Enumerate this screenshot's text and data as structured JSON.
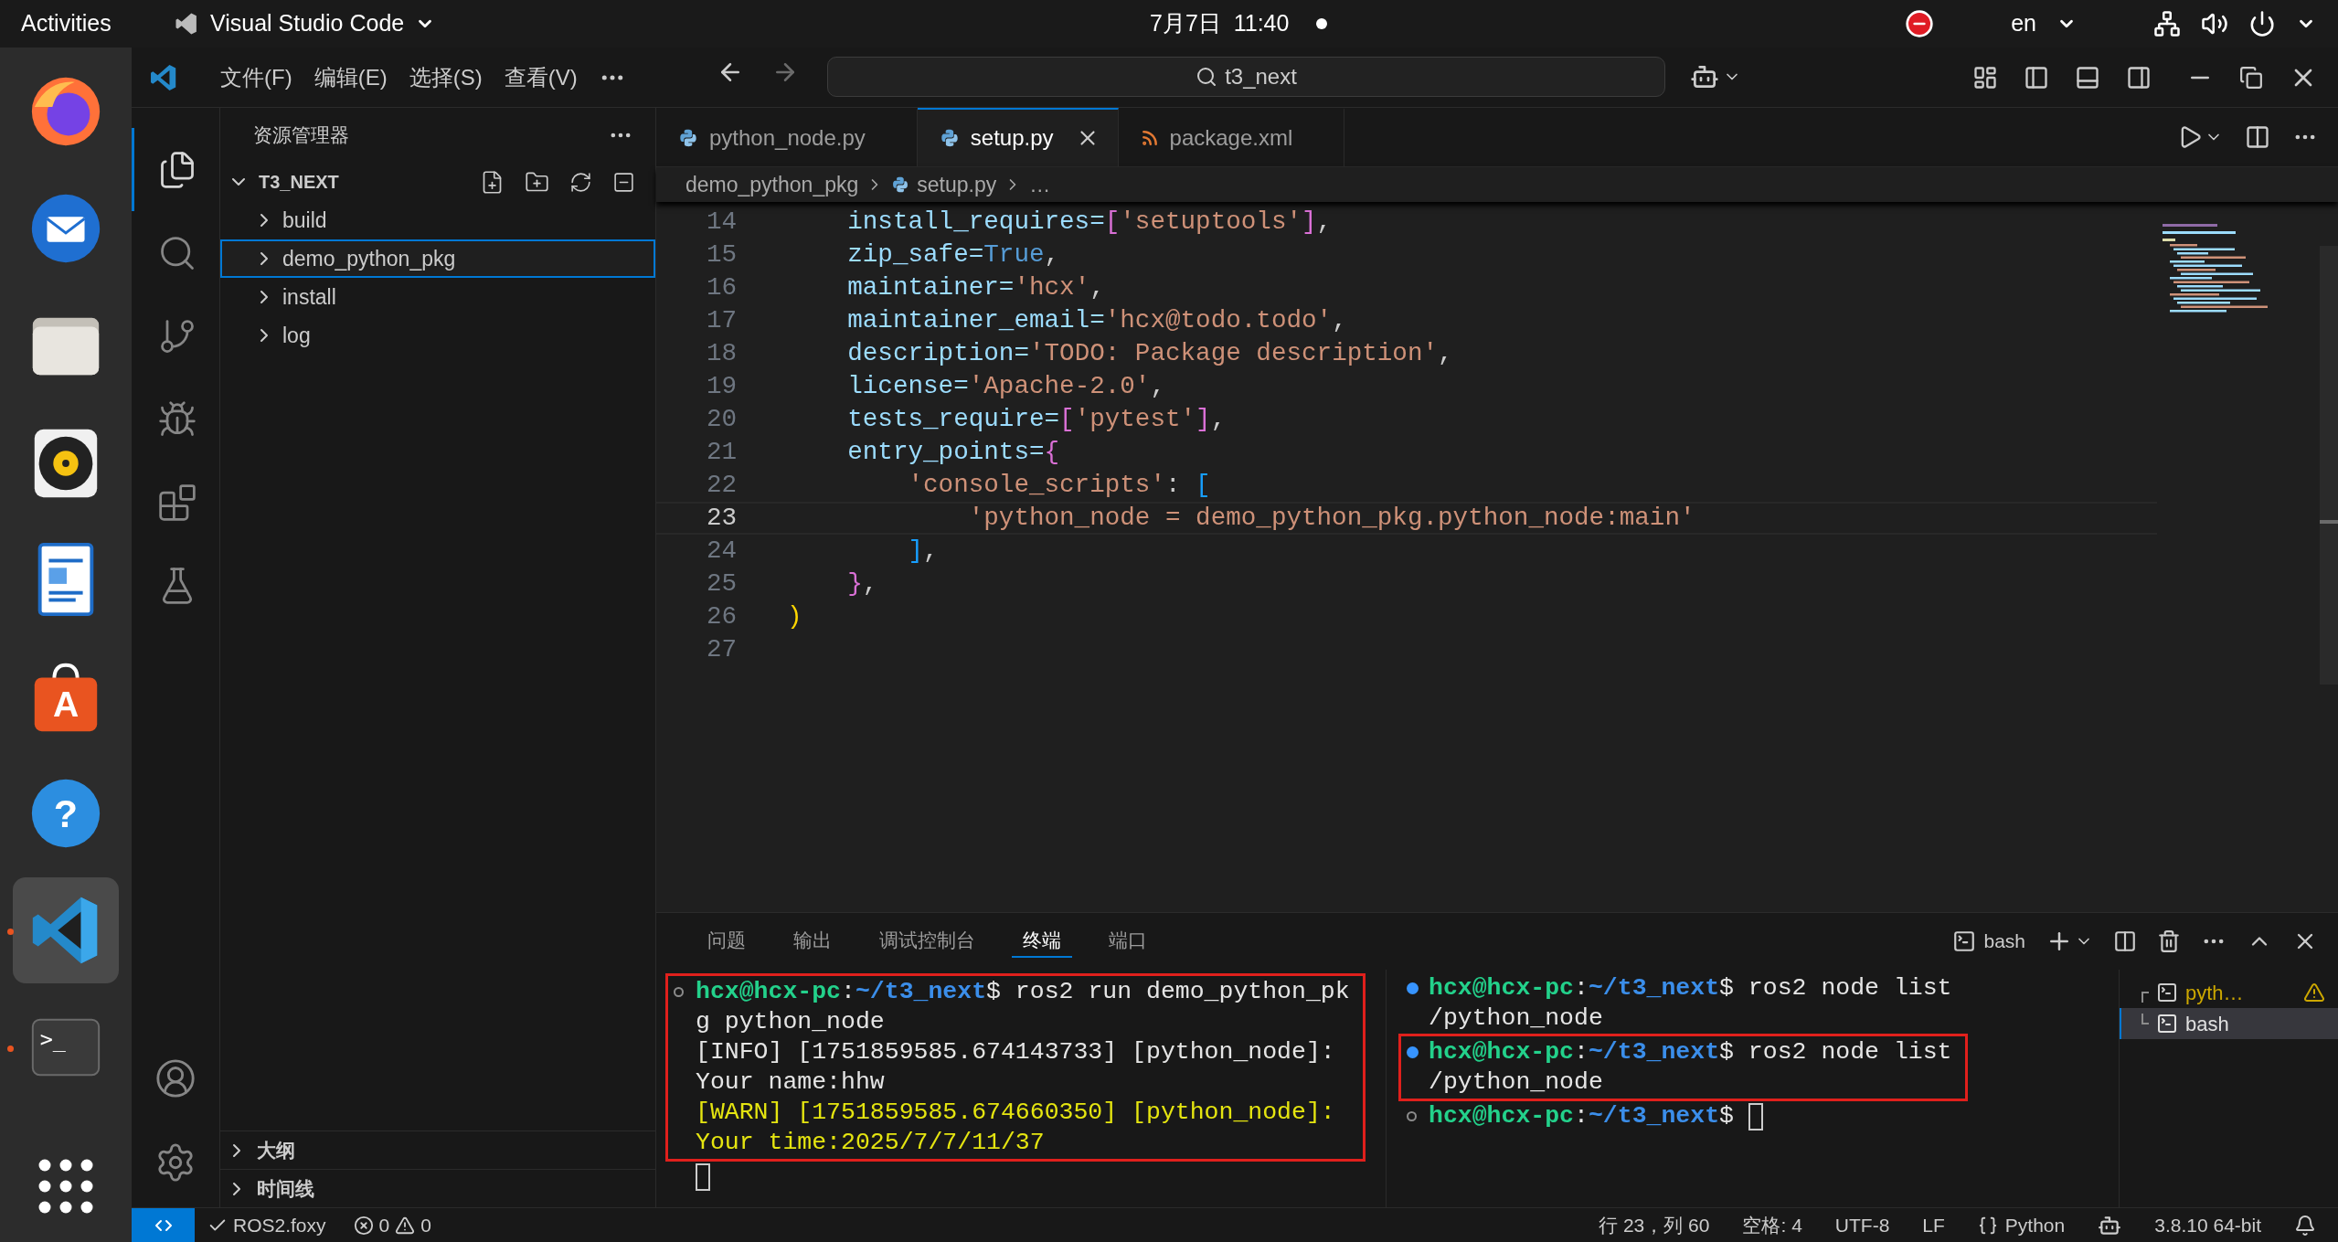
{
  "top_bar": {
    "activities": "Activities",
    "app_name": "Visual Studio Code",
    "date": "7月7日",
    "time": "11:40",
    "keyboard_layout": "en"
  },
  "dock": {
    "items": [
      {
        "kind": "browser",
        "running": false,
        "selected": false
      },
      {
        "kind": "mail",
        "running": false,
        "selected": false
      },
      {
        "kind": "files",
        "running": false,
        "selected": false
      },
      {
        "kind": "music",
        "running": false,
        "selected": false
      },
      {
        "kind": "document",
        "running": false,
        "selected": false
      },
      {
        "kind": "store",
        "glyph": "A",
        "running": false,
        "selected": false
      },
      {
        "kind": "help",
        "glyph": "?",
        "running": false,
        "selected": false
      },
      {
        "kind": "editor",
        "running": true,
        "selected": true
      },
      {
        "kind": "terminal",
        "glyph": ">_",
        "running": true,
        "selected": false
      }
    ]
  },
  "title_bar": {
    "menus": [
      "文件(F)",
      "编辑(E)",
      "选择(S)",
      "查看(V)"
    ],
    "search": "t3_next"
  },
  "activity_bar": {
    "items": [
      {
        "kind": "explorer",
        "selected": true
      },
      {
        "kind": "search",
        "selected": false
      },
      {
        "kind": "source_control",
        "selected": false
      },
      {
        "kind": "debug",
        "selected": false
      },
      {
        "kind": "extensions",
        "selected": false
      },
      {
        "kind": "testing",
        "selected": false
      }
    ]
  },
  "sidebar": {
    "title": "资源管理器",
    "root": {
      "label": "T3_NEXT",
      "expanded": true
    },
    "items": [
      {
        "label": "build",
        "expanded": false,
        "selected": false
      },
      {
        "label": "demo_python_pkg",
        "expanded": false,
        "selected": true
      },
      {
        "label": "install",
        "expanded": false,
        "selected": false
      },
      {
        "label": "log",
        "expanded": false,
        "selected": false
      }
    ],
    "sections": [
      {
        "label": "大纲",
        "expanded": false
      },
      {
        "label": "时间线",
        "expanded": false
      }
    ]
  },
  "tabs": [
    {
      "label": "python_node.py",
      "kind": "python",
      "selected": false
    },
    {
      "label": "setup.py",
      "kind": "python",
      "selected": true
    },
    {
      "label": "package.xml",
      "kind": "xml",
      "selected": false
    }
  ],
  "breadcrumb": [
    {
      "label": "demo_python_pkg",
      "kind": "folder"
    },
    {
      "label": "setup.py",
      "kind": "python"
    },
    {
      "label": "…",
      "kind": "symbol"
    }
  ],
  "editor": {
    "lines": [
      {
        "number": "14",
        "current": false,
        "tokens": [
          {
            "text": "    install_requires=",
            "kind": "key"
          },
          {
            "text": "[",
            "kind": "b1"
          },
          {
            "text": "'setuptools'",
            "kind": "str"
          },
          {
            "text": "]",
            "kind": "b1"
          },
          {
            "text": ",",
            "kind": "op"
          }
        ]
      },
      {
        "number": "15",
        "current": false,
        "tokens": [
          {
            "text": "    zip_safe=",
            "kind": "key"
          },
          {
            "text": "True",
            "kind": "const"
          },
          {
            "text": ",",
            "kind": "op"
          }
        ]
      },
      {
        "number": "16",
        "current": false,
        "tokens": [
          {
            "text": "    maintainer=",
            "kind": "key"
          },
          {
            "text": "'hcx'",
            "kind": "str"
          },
          {
            "text": ",",
            "kind": "op"
          }
        ]
      },
      {
        "number": "17",
        "current": false,
        "tokens": [
          {
            "text": "    maintainer_email=",
            "kind": "key"
          },
          {
            "text": "'hcx@todo.todo'",
            "kind": "str"
          },
          {
            "text": ",",
            "kind": "op"
          }
        ]
      },
      {
        "number": "18",
        "current": false,
        "tokens": [
          {
            "text": "    description=",
            "kind": "key"
          },
          {
            "text": "'TODO: Package description'",
            "kind": "str"
          },
          {
            "text": ",",
            "kind": "op"
          }
        ]
      },
      {
        "number": "19",
        "current": false,
        "tokens": [
          {
            "text": "    license=",
            "kind": "key"
          },
          {
            "text": "'Apache-2.0'",
            "kind": "str"
          },
          {
            "text": ",",
            "kind": "op"
          }
        ]
      },
      {
        "number": "20",
        "current": false,
        "tokens": [
          {
            "text": "    tests_require=",
            "kind": "key"
          },
          {
            "text": "[",
            "kind": "b1"
          },
          {
            "text": "'pytest'",
            "kind": "str"
          },
          {
            "text": "]",
            "kind": "b1"
          },
          {
            "text": ",",
            "kind": "op"
          }
        ]
      },
      {
        "number": "21",
        "current": false,
        "tokens": [
          {
            "text": "    entry_points=",
            "kind": "key"
          },
          {
            "text": "{",
            "kind": "b1"
          }
        ]
      },
      {
        "number": "22",
        "current": false,
        "tokens": [
          {
            "text": "        'console_scripts'",
            "kind": "str"
          },
          {
            "text": ": ",
            "kind": "op"
          },
          {
            "text": "[",
            "kind": "b2"
          }
        ]
      },
      {
        "number": "23",
        "current": true,
        "tokens": [
          {
            "text": "            'python_node = demo_python_pkg.python_node:main'",
            "kind": "str"
          }
        ]
      },
      {
        "number": "24",
        "current": false,
        "tokens": [
          {
            "text": "        ]",
            "kind": "b2"
          },
          {
            "text": ",",
            "kind": "op"
          }
        ]
      },
      {
        "number": "25",
        "current": false,
        "tokens": [
          {
            "text": "    }",
            "kind": "b1"
          },
          {
            "text": ",",
            "kind": "op"
          }
        ]
      },
      {
        "number": "26",
        "current": false,
        "tokens": [
          {
            "text": ")",
            "kind": "b3"
          }
        ]
      },
      {
        "number": "27",
        "current": false
      }
    ]
  },
  "panel": {
    "tabs": [
      {
        "label": "问题",
        "selected": false
      },
      {
        "label": "输出",
        "selected": false
      },
      {
        "label": "调试控制台",
        "selected": false
      },
      {
        "label": "终端",
        "selected": true
      },
      {
        "label": "端口",
        "selected": false
      }
    ],
    "terminal_name": "bash",
    "terminals": [
      {
        "blocks": [
          {
            "highlighted": true,
            "lines": [
              {
                "kind": "pending",
                "tokens": [
                  {
                    "text": "hcx@hcx-pc",
                    "kind": "user"
                  },
                  {
                    "text": ":",
                    "kind": "plain"
                  },
                  {
                    "text": "~/t3_next",
                    "kind": "path"
                  },
                  {
                    "text": "$ ros2 run demo_python_pk",
                    "kind": "plain"
                  }
                ]
              },
              {
                "tokens": [
                  {
                    "text": "g python_node",
                    "kind": "plain"
                  }
                ]
              },
              {
                "tokens": [
                  {
                    "text": "[INFO] [1751859585.674143733] [python_node]:",
                    "kind": "plain"
                  }
                ]
              },
              {
                "tokens": [
                  {
                    "text": "Your name:hhw",
                    "kind": "plain"
                  }
                ]
              },
              {
                "tokens": [
                  {
                    "text": "[WARN] [1751859585.674660350] [python_node]:",
                    "kind": "warn"
                  }
                ]
              },
              {
                "tokens": [
                  {
                    "text": "Your time:2025/7/7/11/37",
                    "kind": "warn"
                  }
                ]
              }
            ]
          },
          {
            "highlighted": false,
            "lines": [
              {
                "cursor": true
              }
            ]
          }
        ]
      },
      {
        "blocks": [
          {
            "highlighted": false,
            "lines": [
              {
                "kind": "done",
                "tokens": [
                  {
                    "text": "hcx@hcx-pc",
                    "kind": "user"
                  },
                  {
                    "text": ":",
                    "kind": "plain"
                  },
                  {
                    "text": "~/t3_next",
                    "kind": "path"
                  },
                  {
                    "text": "$ ros2 node list",
                    "kind": "plain"
                  }
                ]
              },
              {
                "tokens": [
                  {
                    "text": "/python_node",
                    "kind": "plain"
                  }
                ]
              }
            ]
          },
          {
            "highlighted": true,
            "lines": [
              {
                "kind": "done",
                "tokens": [
                  {
                    "text": "hcx@hcx-pc",
                    "kind": "user"
                  },
                  {
                    "text": ":",
                    "kind": "plain"
                  },
                  {
                    "text": "~/t3_next",
                    "kind": "path"
                  },
                  {
                    "text": "$ ros2 node list",
                    "kind": "plain"
                  }
                ]
              },
              {
                "tokens": [
                  {
                    "text": "/python_node",
                    "kind": "plain"
                  }
                ]
              }
            ]
          },
          {
            "highlighted": false,
            "lines": [
              {
                "kind": "pending",
                "cursor": true,
                "tokens": [
                  {
                    "text": "hcx@hcx-pc",
                    "kind": "user"
                  },
                  {
                    "text": ":",
                    "kind": "plain"
                  },
                  {
                    "text": "~/t3_next",
                    "kind": "path"
                  },
                  {
                    "text": "$ ",
                    "kind": "plain"
                  }
                ]
              }
            ]
          }
        ]
      }
    ],
    "terminal_list": [
      {
        "label": "pyth…",
        "selected": false,
        "warning": true
      },
      {
        "label": "bash",
        "selected": true,
        "warning": false
      }
    ]
  },
  "status_bar": {
    "branch": "ROS2.foxy",
    "errors": "0",
    "warnings": "0",
    "position": "行 23，列 60",
    "indent": "空格: 4",
    "encoding": "UTF-8",
    "eol": "LF",
    "language": "Python",
    "interpreter": "3.8.10 64-bit"
  }
}
